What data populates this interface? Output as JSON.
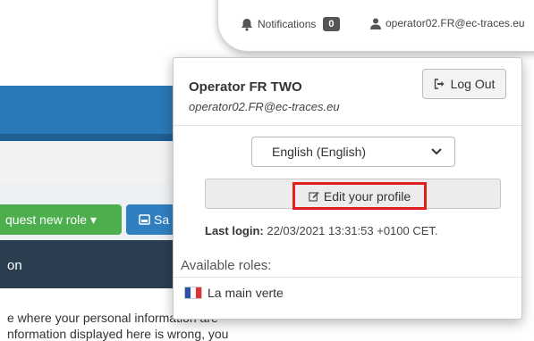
{
  "background": {
    "request_role_label": "quest new role ▾",
    "save_label": "Sa",
    "panel_title": "on",
    "text_line1": "e where your personal information are",
    "text_line2": "nformation displayed here is wrong, you"
  },
  "topbar": {
    "notifications_label": "Notifications",
    "notifications_count": "0",
    "user_email": "operator02.FR@ec-traces.eu"
  },
  "popup": {
    "operator_name": "Operator FR TWO",
    "operator_email": "operator02.FR@ec-traces.eu",
    "logout_label": "Log Out",
    "language_selected": "English (English)",
    "edit_profile_label": "Edit your profile",
    "last_login_label": "Last login:",
    "last_login_value": "22/03/2021 13:31:53 +0100 CET.",
    "available_roles_label": "Available roles:",
    "roles": [
      {
        "label": "La main verte"
      }
    ]
  },
  "colors": {
    "highlight_border": "#e01e1e",
    "primary_blue": "#2b78b6",
    "success_green": "#4cae4c",
    "dark_panel": "#2b3e50"
  },
  "icons": {
    "notifications": "bell-icon",
    "user": "user-icon",
    "logout": "sign-out-icon",
    "edit": "edit-icon",
    "dropdown": "chevron-down-icon",
    "flag": "france-flag-icon",
    "save": "save-icon"
  }
}
